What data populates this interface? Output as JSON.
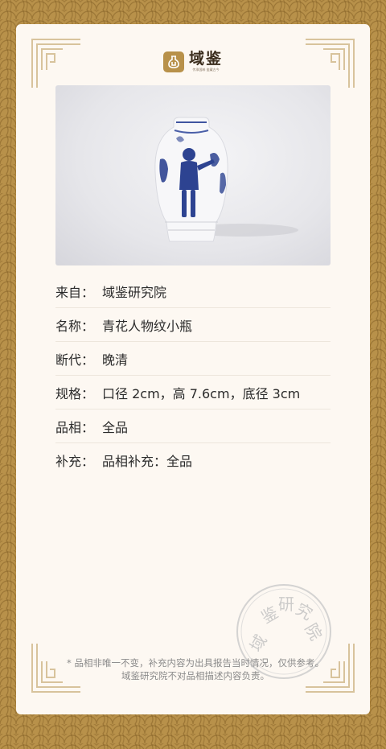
{
  "brand": {
    "name": "域鉴",
    "tagline": "传承国粹 鉴藏古今",
    "accent_color": "#b8914a",
    "icon": "vase-logo-icon"
  },
  "item": {
    "photo_alt": "青花人物纹小瓶"
  },
  "details": [
    {
      "label": "来自：",
      "value": "域鉴研究院"
    },
    {
      "label": "名称：",
      "value": "青花人物纹小瓶"
    },
    {
      "label": "断代：",
      "value": "晚清"
    },
    {
      "label": "规格：",
      "value": "口径 2cm，高 7.6cm，底径 3cm"
    },
    {
      "label": "品相：",
      "value": "全品"
    },
    {
      "label": "补充：",
      "value": "品相补充：全品"
    }
  ],
  "seal": {
    "text": "域鉴研究院"
  },
  "footer_note": "* 品相非唯一不变，补充内容为出具报告当时情况，仅供参考。域鉴研究院不对品相描述内容负责。"
}
